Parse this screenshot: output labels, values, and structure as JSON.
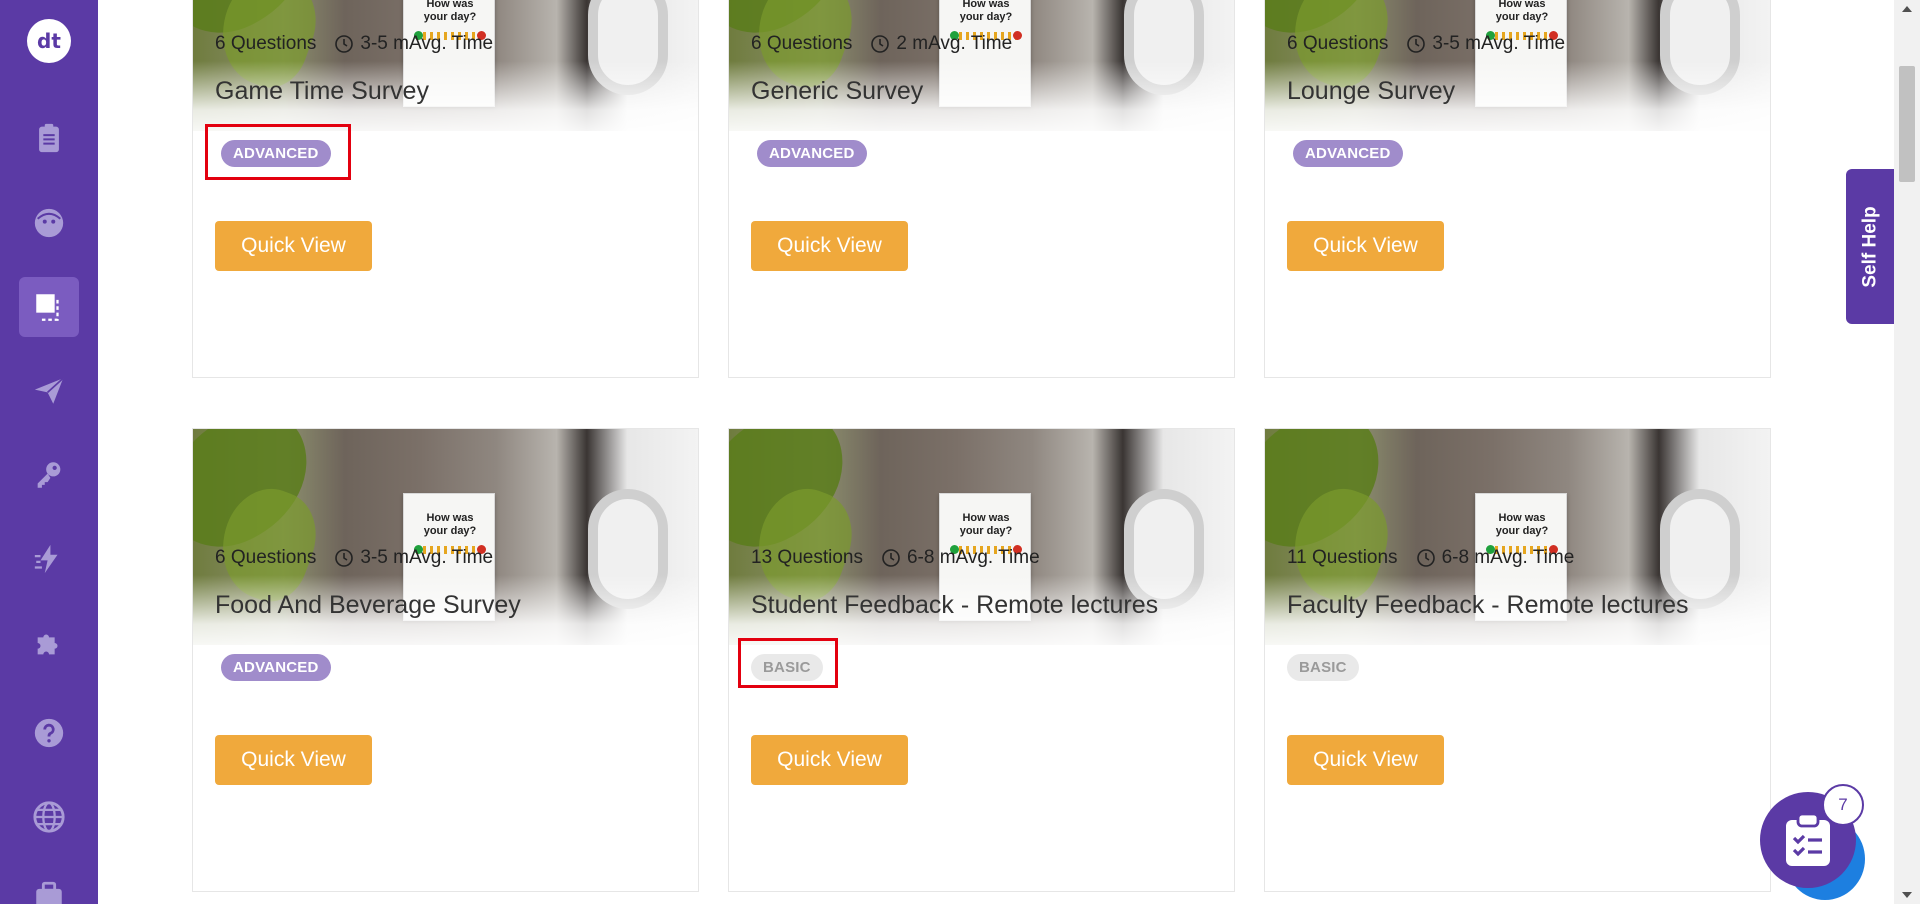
{
  "app": {
    "logo_text": "dt"
  },
  "sidebar": {
    "items": [
      {
        "name": "surveys",
        "icon": "clipboard-icon"
      },
      {
        "name": "contacts",
        "icon": "face-icon"
      },
      {
        "name": "templates",
        "icon": "template-icon",
        "active": true
      },
      {
        "name": "distribute",
        "icon": "send-icon"
      },
      {
        "name": "access",
        "icon": "key-icon"
      },
      {
        "name": "automation",
        "icon": "lightning-icon"
      },
      {
        "name": "integrations",
        "icon": "puzzle-icon"
      },
      {
        "name": "help",
        "icon": "question-icon"
      },
      {
        "name": "language",
        "icon": "globe-icon"
      },
      {
        "name": "account",
        "icon": "briefcase-icon"
      }
    ]
  },
  "cards": [
    {
      "title": "Game Time Survey",
      "questions": "6 Questions",
      "time": "3-5 mAvg. Time",
      "badge": "ADVANCED",
      "button": "Quick View",
      "image_text": "How was your day?"
    },
    {
      "title": "Generic Survey",
      "questions": "6 Questions",
      "time": "2 mAvg. Time",
      "badge": "ADVANCED",
      "button": "Quick View",
      "image_text": "How was your day?"
    },
    {
      "title": "Lounge Survey",
      "questions": "6 Questions",
      "time": "3-5 mAvg. Time",
      "badge": "ADVANCED",
      "button": "Quick View",
      "image_text": "How was your day?"
    },
    {
      "title": "Food And Beverage Survey",
      "questions": "6 Questions",
      "time": "3-5 mAvg. Time",
      "badge": "ADVANCED",
      "button": "Quick View",
      "image_text": "How was your day?"
    },
    {
      "title": "Student Feedback - Remote lectures",
      "questions": "13 Questions",
      "time": "6-8 mAvg. Time",
      "badge": "BASIC",
      "button": "Quick View",
      "image_text": "How was your day?"
    },
    {
      "title": "Faculty Feedback - Remote lectures",
      "questions": "11 Questions",
      "time": "6-8 mAvg. Time",
      "badge": "BASIC",
      "button": "Quick View",
      "image_text": "How was your day?"
    }
  ],
  "self_help": {
    "label": "Self Help"
  },
  "checklist": {
    "count": "7",
    "icon": "checklist-icon"
  },
  "colors": {
    "brand_purple": "#5b3aa5",
    "button_orange": "#f0a93c",
    "advanced_badge": "#a08ccb",
    "basic_badge": "#e9e9e9",
    "highlight_red": "#e3000f"
  }
}
